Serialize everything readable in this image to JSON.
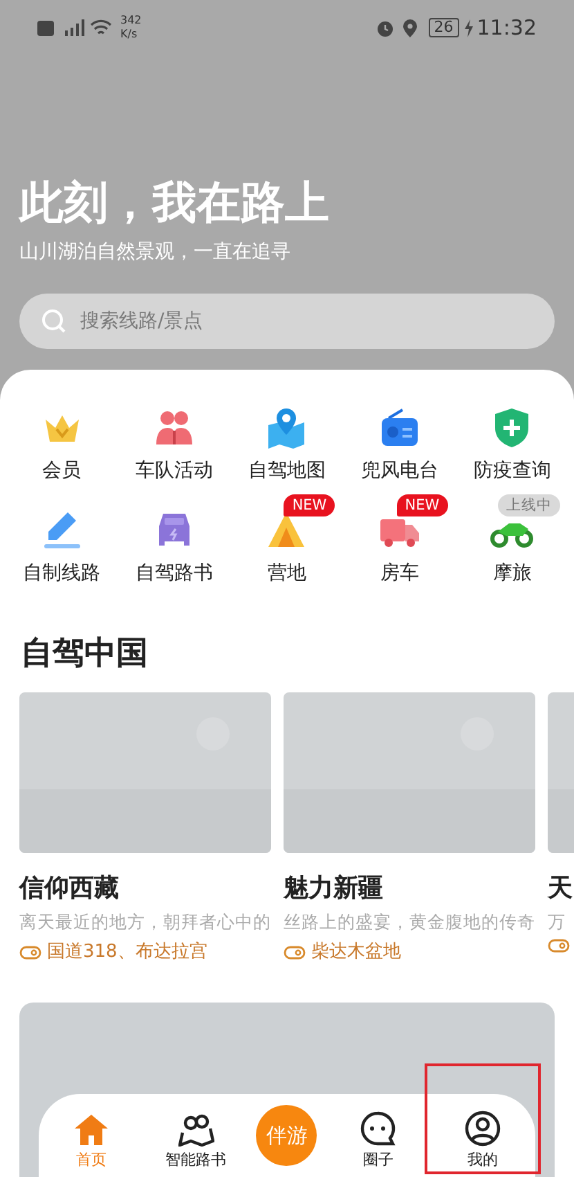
{
  "status_bar": {
    "speed": "342",
    "speed_unit": "K/s",
    "battery": "26",
    "time": "11:32"
  },
  "hero": {
    "title": "此刻，我在路上",
    "subtitle": "山川湖泊自然景观，一直在追寻"
  },
  "search": {
    "placeholder": "搜索线路/景点"
  },
  "shortcuts": [
    {
      "label": "会员"
    },
    {
      "label": "车队活动"
    },
    {
      "label": "自驾地图"
    },
    {
      "label": "兜风电台"
    },
    {
      "label": "防疫查询"
    },
    {
      "label": "自制线路"
    },
    {
      "label": "自驾路书"
    },
    {
      "label": "营地",
      "badge": {
        "text": "NEW",
        "kind": "new"
      }
    },
    {
      "label": "房车",
      "badge": {
        "text": "NEW",
        "kind": "new"
      }
    },
    {
      "label": "摩旅",
      "badge": {
        "text": "上线中",
        "kind": "soon"
      }
    }
  ],
  "section": {
    "title": "自驾中国"
  },
  "routes": [
    {
      "title": "信仰西藏",
      "description": "离天最近的地方，朝拜者心中的",
      "tag": "国道318、布达拉宫"
    },
    {
      "title": "魅力新疆",
      "description": "丝路上的盛宴，黄金腹地的传奇",
      "tag": "柴达木盆地"
    },
    {
      "title": "天",
      "description": "万"
    }
  ],
  "nav": [
    {
      "label": "首页",
      "kind": "tab",
      "selected": true,
      "highlighted": false
    },
    {
      "label": "智能路书",
      "kind": "tab",
      "selected": false,
      "highlighted": false
    },
    {
      "label": "伴游",
      "kind": "center",
      "selected": false,
      "highlighted": false
    },
    {
      "label": "圈子",
      "kind": "tab",
      "selected": false,
      "highlighted": false
    },
    {
      "label": "我的",
      "kind": "tab",
      "selected": false,
      "highlighted": true
    }
  ]
}
